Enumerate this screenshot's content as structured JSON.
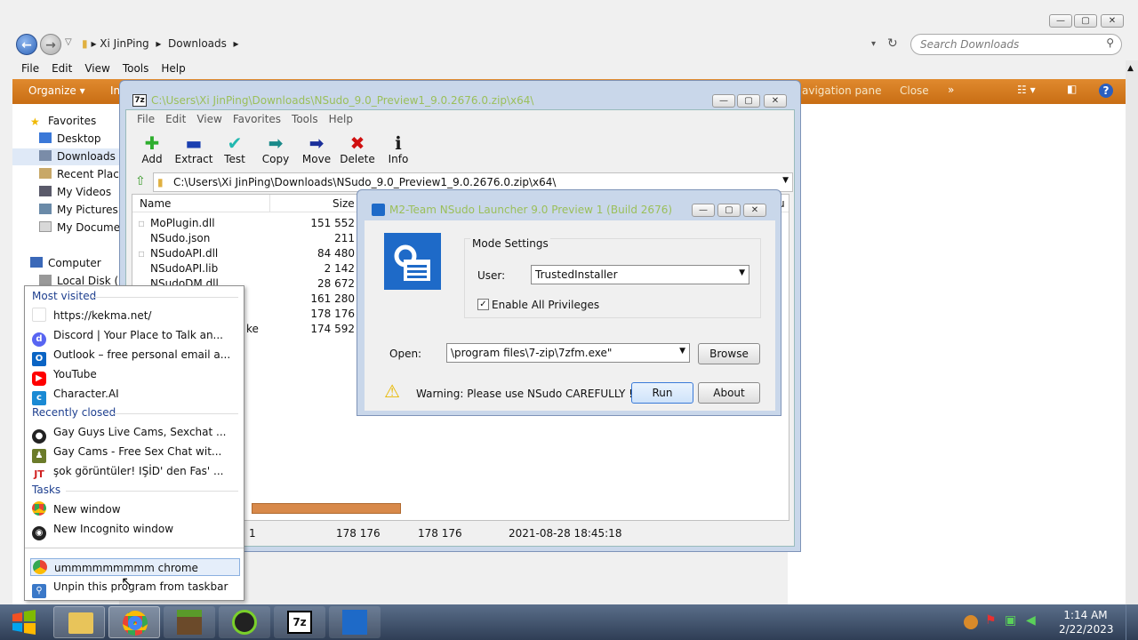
{
  "explorer": {
    "breadcrumb": [
      "Xi JinPing",
      "Downloads"
    ],
    "search_placeholder": "Search Downloads",
    "menu": [
      "File",
      "Edit",
      "View",
      "Tools",
      "Help"
    ],
    "organize_label": "Organize ▾",
    "organize_extra": "In",
    "nav_pane_label": "avigation pane",
    "close_label": "Close",
    "more_label": "»",
    "nav": {
      "favorites": "Favorites",
      "desktop": "Desktop",
      "downloads": "Downloads",
      "recent": "Recent Plac",
      "videos": "My Videos",
      "pictures": "My Pictures",
      "documents": "My Documer",
      "computer": "Computer",
      "local_disk": "Local Disk ("
    }
  },
  "zip": {
    "title": "C:\\Users\\Xi JinPing\\Downloads\\NSudo_9.0_Preview1_9.0.2676.0.zip\\x64\\",
    "menu": [
      "File",
      "Edit",
      "View",
      "Favorites",
      "Tools",
      "Help"
    ],
    "toolbar": [
      {
        "label": "Add",
        "icon": "plus-icon",
        "color": "#2eae2e"
      },
      {
        "label": "Extract",
        "icon": "minus-icon",
        "color": "#1a3fb0"
      },
      {
        "label": "Test",
        "icon": "check-icon",
        "color": "#22b8b0"
      },
      {
        "label": "Copy",
        "icon": "copy-arrow-icon",
        "color": "#1a8a8a"
      },
      {
        "label": "Move",
        "icon": "move-arrow-icon",
        "color": "#1a2f9a"
      },
      {
        "label": "Delete",
        "icon": "delete-x-icon",
        "color": "#d01010"
      },
      {
        "label": "Info",
        "icon": "info-icon",
        "color": "#1a1a1a"
      }
    ],
    "path": "C:\\Users\\Xi JinPing\\Downloads\\NSudo_9.0_Preview1_9.0.2676.0.zip\\x64\\",
    "columns": {
      "name": "Name",
      "size": "Size"
    },
    "files": [
      {
        "name": "MoPlugin.dll",
        "size": "151 552"
      },
      {
        "name": "NSudo.json",
        "size": "211"
      },
      {
        "name": "NSudoAPI.dll",
        "size": "84 480"
      },
      {
        "name": "NSudoAPI.lib",
        "size": "2 142"
      },
      {
        "name": "NSudoDM.dll",
        "size": "28 672"
      },
      {
        "name": "",
        "size": "161 280"
      },
      {
        "name": "",
        "size": "178 176"
      },
      {
        "name": "ke",
        "size": "174 592"
      }
    ],
    "status": {
      "a": "1",
      "b": "178 176",
      "c": "178 176",
      "d": "2021-08-28 18:45:18"
    }
  },
  "nsudo": {
    "title": "M2-Team NSudo Launcher 9.0 Preview 1 (Build 2676)",
    "mode_settings": "Mode Settings",
    "user_label": "User:",
    "user_value": "TrustedInstaller",
    "privileges": "Enable All Privileges",
    "open_label": "Open:",
    "open_value": "\\program files\\7-zip\\7zfm.exe\"",
    "browse": "Browse",
    "warning": "Warning: Please use NSudo CAREFULLY !",
    "run": "Run",
    "about": "About",
    "partial": "u"
  },
  "jumplist": {
    "most_visited": "Most visited",
    "mv_items": [
      {
        "label": "https://kekma.net/",
        "icon": "blank-page-icon",
        "color": "#ffffff"
      },
      {
        "label": "Discord | Your Place to Talk an...",
        "icon": "discord-icon",
        "color": "#5865f2"
      },
      {
        "label": "Outlook – free personal email a...",
        "icon": "outlook-icon",
        "color": "#0a64c4"
      },
      {
        "label": "YouTube",
        "icon": "youtube-icon",
        "color": "#ff0000"
      },
      {
        "label": "Character.AI",
        "icon": "character-ai-icon",
        "color": "#1a8ad4"
      }
    ],
    "recently_closed": "Recently closed",
    "rc_items": [
      {
        "label": "Gay Guys Live Cams, Sexchat ...",
        "icon": "cam-site-icon",
        "color": "#222222"
      },
      {
        "label": "Gay Cams - Free Sex Chat wit...",
        "icon": "cam-site-icon",
        "color": "#6b7b2a"
      },
      {
        "label": "şok görüntüler! IŞİD' den Fas' ...",
        "icon": "jt-icon",
        "color": "#d02020"
      }
    ],
    "tasks": "Tasks",
    "task_items": [
      {
        "label": "New window",
        "icon": "chrome-icon",
        "color": "#4285f4"
      },
      {
        "label": "New Incognito window",
        "icon": "incognito-icon",
        "color": "#222222"
      }
    ],
    "pinned": "ummmmmmmmm chrome",
    "unpin": "Unpin this program from taskbar"
  },
  "taskbar": {
    "time": "1:14 AM",
    "date": "2/22/2023",
    "apps": [
      "start-button",
      "explorer",
      "chrome",
      "minecraft",
      "hook-app",
      "7-zip",
      "nsudo"
    ]
  }
}
